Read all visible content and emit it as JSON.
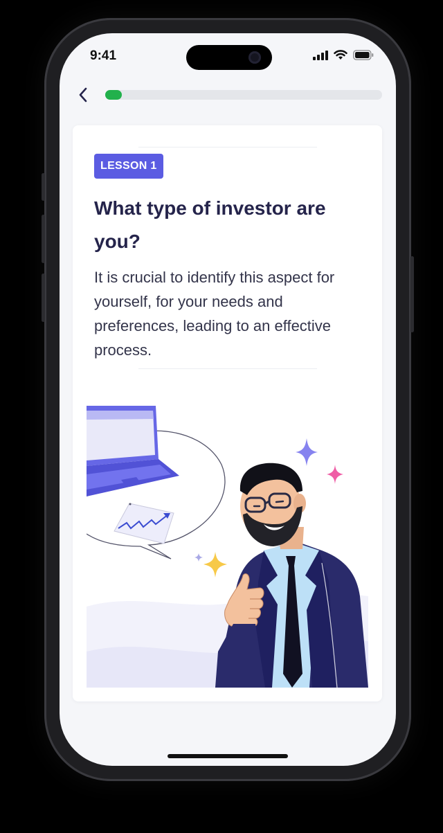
{
  "status_bar": {
    "time": "9:41",
    "icons": [
      "cellular-signal-icon",
      "wifi-icon",
      "battery-icon"
    ]
  },
  "nav": {
    "back_icon": "chevron-left-icon",
    "progress": 0.06
  },
  "lesson": {
    "badge": "LESSON 1",
    "title": "What type of investor are you?",
    "body": "It is crucial to identify this aspect for yourself, for your needs and preferences, leading to an effective process."
  },
  "colors": {
    "accent": "#5b5ce2",
    "progress": "#22b14c",
    "title": "#25244b",
    "background": "#f5f6f9"
  },
  "illustration": {
    "subject": "smiling businessman giving thumbs up with laptop and growth chart speech bubble"
  }
}
